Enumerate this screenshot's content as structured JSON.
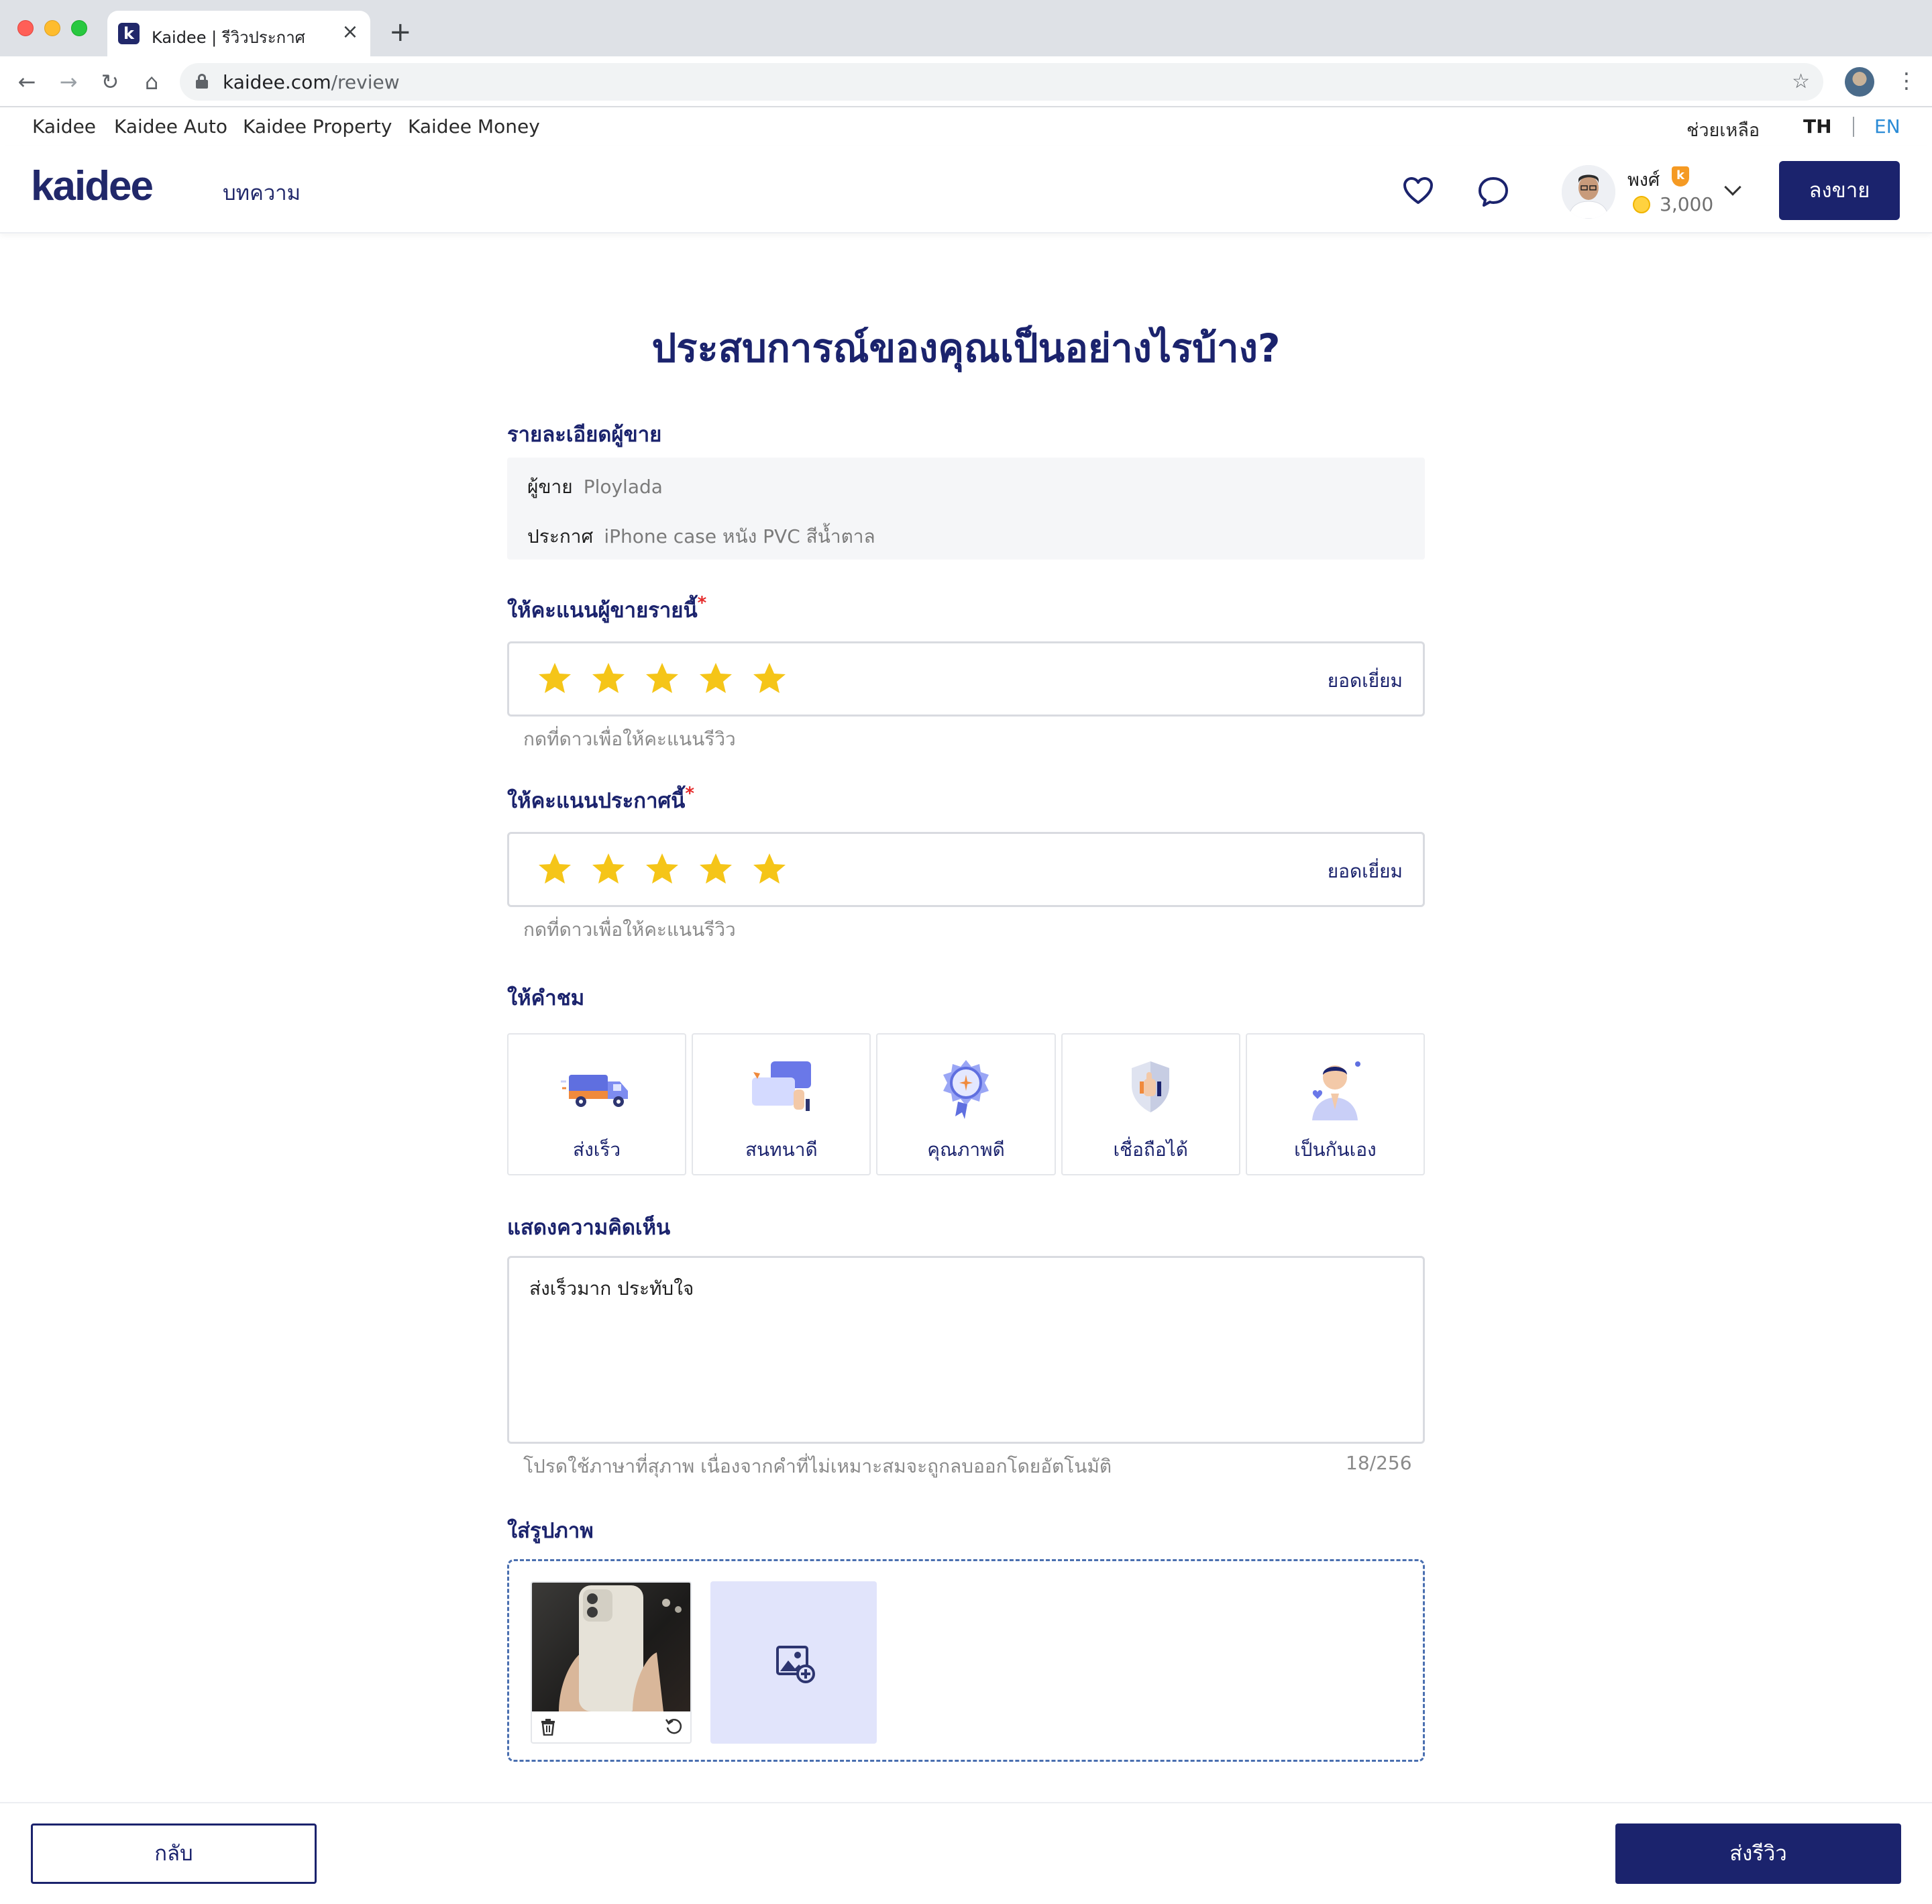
{
  "browser": {
    "tab_title": "Kaidee | รีวิวประกาศ",
    "favicon_letter": "k",
    "url_host": "kaidee.com",
    "url_path": "/review"
  },
  "topbar": {
    "links": [
      "Kaidee",
      "Kaidee Auto",
      "Kaidee Property",
      "Kaidee Money"
    ],
    "help": "ช่วยเหลือ",
    "lang_th": "TH",
    "lang_en": "EN"
  },
  "header": {
    "logo": "kaidee",
    "nav_article": "บทความ",
    "user_name": "พงศ์",
    "user_badge": "k",
    "coins": "3,000",
    "sell_button": "ลงขาย"
  },
  "form": {
    "title": "ประสบการณ์ของคุณเป็นอย่างไรบ้าง?",
    "seller_section_label": "รายละเอียดผู้ขาย",
    "seller_key": "ผู้ขาย",
    "seller_value": "Ploylada",
    "listing_key": "ประกาศ",
    "listing_value": "iPhone case หนัง PVC สีน้ำตาล",
    "seller_rating_label": "ให้คะแนนผู้ขายรายนี้",
    "seller_rating": 5,
    "seller_rating_text": "ยอดเยี่ยม",
    "seller_rating_hint": "กดที่ดาวเพื่อให้คะแนนรีวิว",
    "listing_rating_label": "ให้คะแนนประกาศนี้",
    "listing_rating": 5,
    "listing_rating_text": "ยอดเยี่ยม",
    "listing_rating_hint": "กดที่ดาวเพื่อให้คะแนนรีวิว",
    "required_mark": "*",
    "compliments_label": "ให้คำชม",
    "compliments": [
      {
        "label": "ส่งเร็ว",
        "icon": "truck-icon"
      },
      {
        "label": "สนทนาดี",
        "icon": "chat-bubbles-icon"
      },
      {
        "label": "คุณภาพดี",
        "icon": "quality-badge-icon"
      },
      {
        "label": "เชื่อถือได้",
        "icon": "shield-thumb-icon"
      },
      {
        "label": "เป็นกันเอง",
        "icon": "friendly-person-icon"
      }
    ],
    "comment_label": "แสดงความคิดเห็น",
    "comment_value": "ส่งเร็วมาก ประทับใจ",
    "comment_hint": "โปรดใช้ภาษาที่สุภาพ เนื่องจากคำที่ไม่เหมาะสมจะถูกลบออกโดยอัตโนมัติ",
    "comment_count": "18/256",
    "photo_label": "ใส่รูปภาพ"
  },
  "footer": {
    "back_button": "กลับ",
    "submit_button": "ส่งรีวิว"
  },
  "colors": {
    "brand_navy": "#1b236d",
    "star_yellow": "#f5c518",
    "required_red": "#e52b2b",
    "link_blue": "#2a8bd6"
  }
}
